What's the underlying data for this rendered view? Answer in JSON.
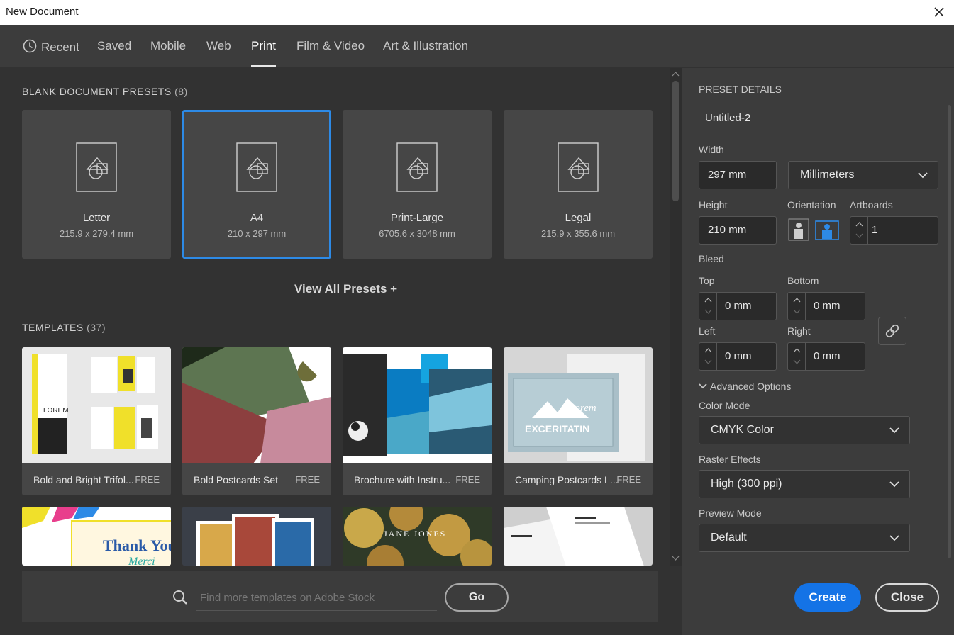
{
  "window": {
    "title": "New Document"
  },
  "tabs": [
    {
      "label": "Recent"
    },
    {
      "label": "Saved"
    },
    {
      "label": "Mobile"
    },
    {
      "label": "Web"
    },
    {
      "label": "Print"
    },
    {
      "label": "Film & Video"
    },
    {
      "label": "Art & Illustration"
    }
  ],
  "active_tab": "Print",
  "presets": {
    "title": "BLANK DOCUMENT PRESETS",
    "count": "(8)",
    "items": [
      {
        "name": "Letter",
        "dims": "215.9 x 279.4 mm"
      },
      {
        "name": "A4",
        "dims": "210 x 297 mm",
        "selected": true
      },
      {
        "name": "Print-Large",
        "dims": "6705.6 x 3048 mm"
      },
      {
        "name": "Legal",
        "dims": "215.9 x 355.6 mm"
      }
    ],
    "view_all": "View All Presets +"
  },
  "templates": {
    "title": "TEMPLATES",
    "count": "(37)",
    "items": [
      {
        "name": "Bold and Bright Trifol...",
        "badge": "FREE"
      },
      {
        "name": "Bold Postcards Set",
        "badge": "FREE"
      },
      {
        "name": "Brochure with Instru...",
        "badge": "FREE"
      },
      {
        "name": "Camping Postcards L...",
        "badge": "FREE"
      }
    ],
    "thumb_text": {
      "lorem": "LOREM",
      "thank_you": "Thank You",
      "merci": "Merci",
      "jane_jones": "JANE JONES",
      "lorem_script": "Lorem",
      "exceritatin": "EXCERITATIN"
    }
  },
  "search": {
    "placeholder": "Find more templates on Adobe Stock",
    "go_label": "Go"
  },
  "details": {
    "title": "PRESET DETAILS",
    "doc_name": "Untitled-2",
    "width_label": "Width",
    "width_value": "297 mm",
    "units": "Millimeters",
    "height_label": "Height",
    "height_value": "210 mm",
    "orientation_label": "Orientation",
    "orientation": "landscape",
    "artboards_label": "Artboards",
    "artboards_value": "1",
    "bleed_label": "Bleed",
    "bleed": {
      "top_label": "Top",
      "top": "0 mm",
      "bottom_label": "Bottom",
      "bottom": "0 mm",
      "left_label": "Left",
      "left": "0 mm",
      "right_label": "Right",
      "right": "0 mm"
    },
    "advanced_label": "Advanced Options",
    "color_mode_label": "Color Mode",
    "color_mode": "CMYK Color",
    "raster_label": "Raster Effects",
    "raster": "High (300 ppi)",
    "preview_label": "Preview Mode",
    "preview": "Default",
    "create_label": "Create",
    "close_label": "Close"
  },
  "colors": {
    "accent": "#1473e6",
    "selection": "#2d8ae6",
    "panel": "#3c3c3c",
    "background": "#323232"
  }
}
